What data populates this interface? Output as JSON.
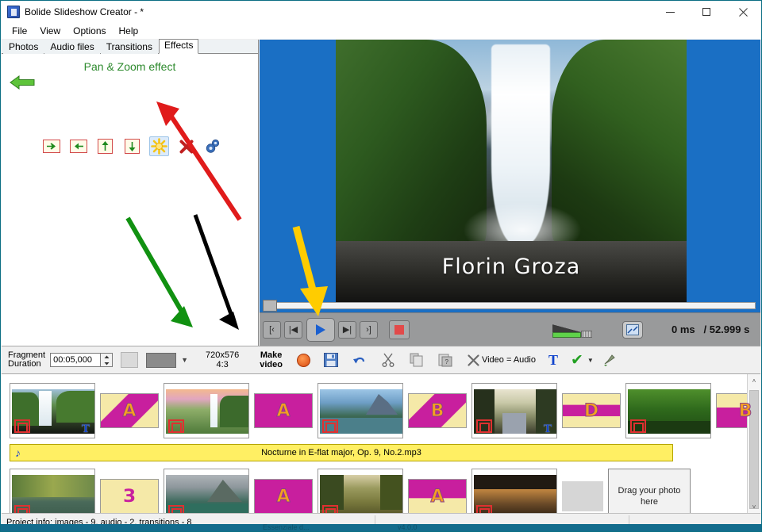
{
  "window": {
    "title": "Bolide Slideshow Creator - *",
    "icon": "app-icon",
    "minimize": "—",
    "maximize": "☐",
    "close": "✕"
  },
  "menu": {
    "items": [
      "File",
      "View",
      "Options",
      "Help"
    ]
  },
  "left_panel": {
    "tabs": [
      {
        "label": "Photos",
        "active": false
      },
      {
        "label": "Audio files",
        "active": false
      },
      {
        "label": "Transitions",
        "active": false
      },
      {
        "label": "Effects",
        "active": true
      }
    ],
    "pane_title": "Pan & Zoom effect",
    "back_arrow_icon": "back-arrow-icon",
    "effect_buttons": [
      {
        "name": "pan-right-icon",
        "selected": false
      },
      {
        "name": "pan-left-icon",
        "selected": false
      },
      {
        "name": "pan-up-icon",
        "selected": false
      },
      {
        "name": "pan-down-icon",
        "selected": false
      },
      {
        "name": "zoom-burst-icon",
        "selected": true
      },
      {
        "name": "remove-effect-icon",
        "selected": false
      },
      {
        "name": "effect-settings-icon",
        "selected": false
      }
    ]
  },
  "preview": {
    "overlay_text": "Florin Groza",
    "background_color": "#1a6fc4"
  },
  "player": {
    "buttons": [
      {
        "name": "go-to-start-button",
        "glyph": "[‹"
      },
      {
        "name": "previous-frame-button",
        "glyph": "|◀"
      },
      {
        "name": "play-button",
        "glyph": "▶"
      },
      {
        "name": "next-frame-button",
        "glyph": "▶|"
      },
      {
        "name": "go-to-end-button",
        "glyph": "›]"
      }
    ],
    "stop_button": "stop-button",
    "volume_label": "volume-slider",
    "fullscreen_button": "fullscreen-button",
    "time_current": "0 ms",
    "time_total": "/ 52.999 s"
  },
  "toolbar": {
    "fragment_label_line1": "Fragment",
    "fragment_label_line2": "Duration",
    "fragment_value": "00:05,000",
    "spin_glyph": "⬍",
    "resolution_line1": "720x576",
    "resolution_line2": "4:3",
    "make_video_line1": "Make",
    "make_video_line2": "video",
    "record_button": "burn-disc-button",
    "save_button": "save-button",
    "undo_button": "undo-button",
    "cut_button": "cut-button",
    "copy_button": "copy-button",
    "paste_button": "paste-button",
    "delete_button": "delete-button",
    "video_audio_text": "Video = Audio",
    "text_tool": "T",
    "apply_check": "✔",
    "apply_caret": "▼",
    "brush_tool": "brush-button",
    "dropdown_caret": "▼"
  },
  "timeline": {
    "row1": [
      {
        "type": "photo",
        "name": "photo-thumb-1",
        "scene": "waterfall-cliff",
        "has_text": true
      },
      {
        "type": "transition",
        "name": "transition-thumb-1",
        "letter": "A",
        "style": "diag"
      },
      {
        "type": "photo",
        "name": "photo-thumb-2",
        "scene": "sunset-waterfall",
        "has_text": false
      },
      {
        "type": "transition",
        "name": "transition-thumb-2",
        "letter": "A",
        "style": "plain"
      },
      {
        "type": "photo",
        "name": "photo-thumb-3",
        "scene": "mountain-lake",
        "has_text": false
      },
      {
        "type": "transition",
        "name": "transition-thumb-3",
        "letter": "B",
        "style": "diag"
      },
      {
        "type": "photo",
        "name": "photo-thumb-4",
        "scene": "forest-road",
        "has_text": true
      },
      {
        "type": "transition",
        "name": "transition-thumb-4",
        "letter": "D",
        "style": "band"
      },
      {
        "type": "photo",
        "name": "photo-thumb-5",
        "scene": "green-jungle-pond",
        "has_text": false
      },
      {
        "type": "transition",
        "name": "transition-thumb-5",
        "letter": "B",
        "style": "stack"
      }
    ],
    "audio_track": {
      "name": "audio-clip",
      "label": "Nocturne in E-flat major, Op. 9, No.2.mp3",
      "icon": "music-note-icon"
    },
    "row2": [
      {
        "type": "photo",
        "name": "photo-thumb-6",
        "scene": "autumn-lake",
        "has_text": false
      },
      {
        "type": "transition",
        "name": "transition-thumb-6",
        "letter": "З",
        "style": "wipe"
      },
      {
        "type": "photo",
        "name": "photo-thumb-7",
        "scene": "alpine-lake",
        "has_text": false
      },
      {
        "type": "transition",
        "name": "transition-thumb-7",
        "letter": "A",
        "style": "plain"
      },
      {
        "type": "photo",
        "name": "photo-thumb-8",
        "scene": "autumn-path",
        "has_text": false
      },
      {
        "type": "transition",
        "name": "transition-thumb-8",
        "letter": "A",
        "style": "stack"
      },
      {
        "type": "photo",
        "name": "photo-thumb-9",
        "scene": "golden-river",
        "has_text": false
      },
      {
        "type": "blank",
        "name": "empty-slot"
      },
      {
        "type": "drop",
        "name": "drop-photo-placeholder",
        "label": "Drag your photo\nhere"
      }
    ],
    "scroll_up": "˄",
    "scroll_down": "˅"
  },
  "statusbar": {
    "text": "Project info: images - 9, audio - 2, transitions - 8"
  },
  "background_window": {
    "left_text": "Essenziale d...",
    "right_text": "v4.0.0"
  },
  "annotations": [
    {
      "name": "red-arrow-annotation",
      "color": "#e01b1b",
      "points_to": "zoom-burst-icon"
    },
    {
      "name": "green-arrow-annotation",
      "color": "#119111",
      "points_to": "fragment-duration"
    },
    {
      "name": "black-arrow-annotation",
      "color": "#000000",
      "points_to": "make-video-button"
    },
    {
      "name": "yellow-arrow-annotation",
      "color": "#ffcc00",
      "points_to": "play-button"
    }
  ]
}
